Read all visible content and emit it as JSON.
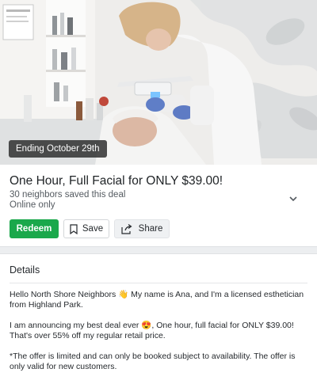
{
  "deal": {
    "ending_badge": "Ending October 29th",
    "title": "One Hour, Full Facial for ONLY $39.00!",
    "saved_count": "30 neighbors saved this deal",
    "availability": "Online only",
    "actions": {
      "redeem": "Redeem",
      "save": "Save",
      "share": "Share"
    }
  },
  "details": {
    "heading": "Details",
    "paragraphs": [
      "Hello North Shore Neighbors 👋 My name is Ana, and I'm a licensed esthetician from Highland Park.",
      "I am announcing my best deal ever 😍, One hour, full facial for ONLY $39.00! That's over 55% off my regular retail price.",
      "*The offer is limited and can only be booked subject to availability. The offer is only valid for new customers."
    ]
  },
  "colors": {
    "redeem_green": "#1aa84b",
    "badge_bg": "#282828",
    "page_bg": "#eceef0"
  }
}
